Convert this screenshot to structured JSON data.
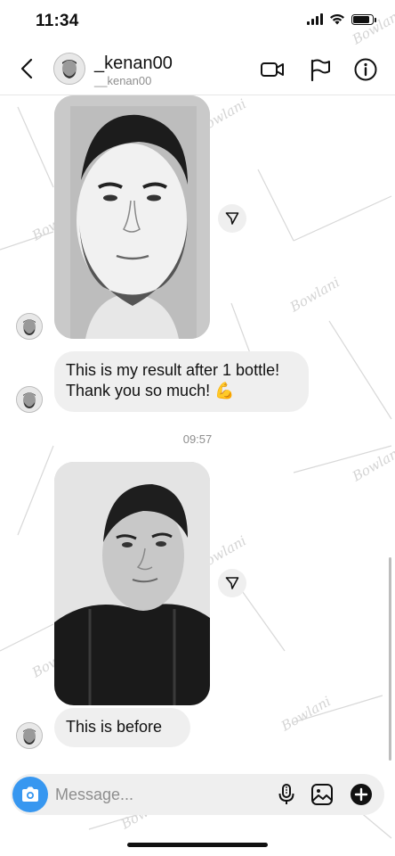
{
  "status_bar": {
    "time": "11:34",
    "battery_level": 0.85
  },
  "header": {
    "display_name": "_kenan00",
    "username": "__kenan00",
    "icons": [
      "back-icon",
      "video-call-icon",
      "flag-icon",
      "info-icon"
    ]
  },
  "messages": [
    {
      "type": "photo",
      "sender": "them",
      "description": "before-after-photo"
    },
    {
      "type": "text",
      "sender": "them",
      "lines": [
        "This is my result after 1 bottle!",
        "Thank you so much! 💪"
      ]
    },
    {
      "type": "timestamp",
      "text": "09:57"
    },
    {
      "type": "photo",
      "sender": "them",
      "description": "selfie-photo"
    },
    {
      "type": "text",
      "sender": "them",
      "lines": [
        "This is before"
      ]
    }
  ],
  "composer": {
    "placeholder": "Message...",
    "value": ""
  },
  "colors": {
    "accent": "#3797f0",
    "bubble": "#efefef",
    "secondary_text": "#8e8e8e"
  }
}
